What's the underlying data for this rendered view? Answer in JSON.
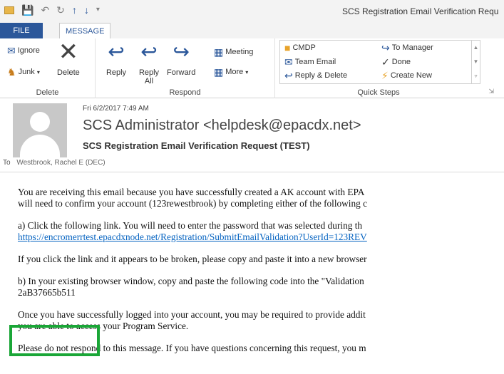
{
  "window": {
    "title": "SCS Registration Email Verification Requ"
  },
  "quick_access": {
    "icons": [
      "envelope-icon",
      "save-icon",
      "undo-icon",
      "redo-icon",
      "up-arrow-icon",
      "down-arrow-icon",
      "customize-icon"
    ]
  },
  "tabs": {
    "file": "FILE",
    "message": "MESSAGE"
  },
  "ribbon": {
    "delete_group": {
      "label": "Delete",
      "ignore": "Ignore",
      "junk": "Junk",
      "delete": "Delete"
    },
    "respond_group": {
      "label": "Respond",
      "reply": "Reply",
      "reply_all_line1": "Reply",
      "reply_all_line2": "All",
      "forward": "Forward",
      "meeting": "Meeting",
      "more": "More"
    },
    "quick_steps_group": {
      "label": "Quick Steps",
      "items": [
        "CMDP",
        "Team Email",
        "Reply & Delete",
        "To Manager",
        "Done",
        "Create New"
      ]
    }
  },
  "header": {
    "date": "Fri 6/2/2017 7:49 AM",
    "sender": "SCS Administrator <helpdesk@epacdx.net>",
    "subject": "SCS Registration Email Verification Request (TEST)",
    "to_label": "To",
    "to_name": "Westbrook, Rachel E (DEC)"
  },
  "body": {
    "p1_line1": "You are receiving this email because you have successfully created a AK account with EPA",
    "p1_line2": "will need to confirm your account (123rewestbrook) by completing either of the following c",
    "p2_line1": "a) Click the following link. You will need to enter the password that was selected during th",
    "p2_link": "https://encromerrtest.epacdxnode.net/Registration/SubmitEmailValidation?UserId=123REV",
    "p3": "If you click the link and it appears to be broken, please copy and paste it into a new browser",
    "p4_line1": "b) In your existing browser window, copy and paste the following code into the \"Validation",
    "p4_code": "2aB37665b511",
    "p5_line1": "Once you have successfully logged into your account, you may be required to provide addit",
    "p5_line2": "you are able to access your Program Service.",
    "p6": "Please do not respond to this message. If you have questions concerning this request, you m"
  },
  "colors": {
    "file_tab": "#2b579a",
    "highlight_box": "#1aa637",
    "link": "#0563c1"
  }
}
